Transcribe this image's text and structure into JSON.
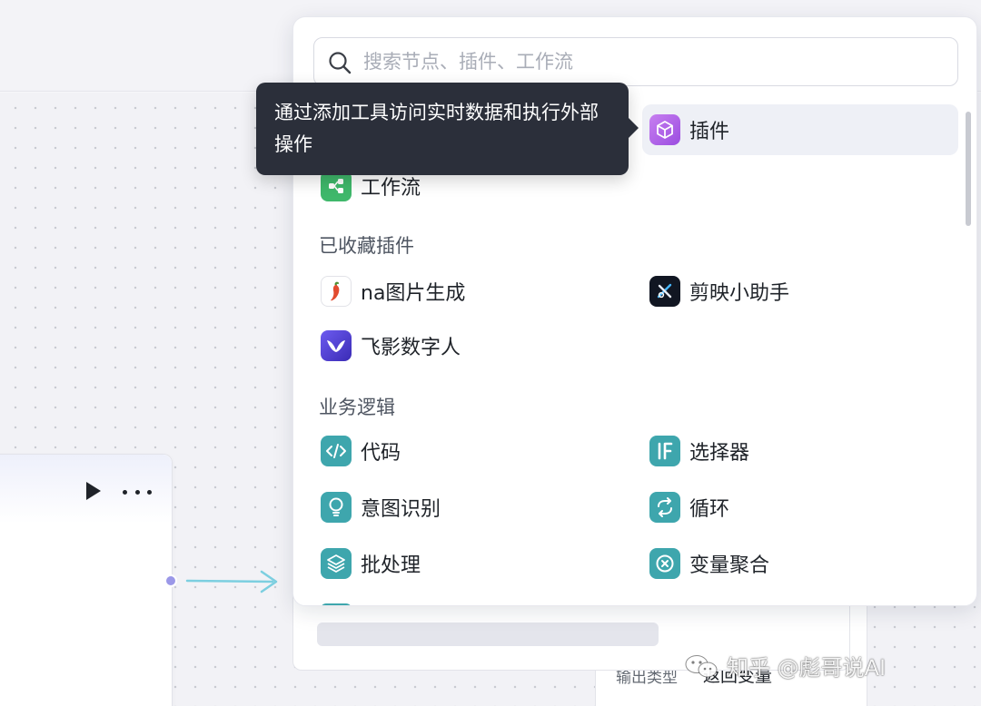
{
  "search": {
    "placeholder": "搜索节点、插件、工作流"
  },
  "tooltip": {
    "text": "通过添加工具访问实时数据和执行外部操作"
  },
  "tools": {
    "plugin_label": "插件",
    "workflow_label": "工作流"
  },
  "favorites": {
    "title": "已收藏插件",
    "items": [
      {
        "label": "na图片生成",
        "icon": "chili-pepper-icon"
      },
      {
        "label": "剪映小助手",
        "icon": "jianying-icon"
      },
      {
        "label": "飞影数字人",
        "icon": "feiying-icon"
      }
    ]
  },
  "business_logic": {
    "title": "业务逻辑",
    "items": [
      {
        "label": "代码",
        "icon": "code-icon"
      },
      {
        "label": "选择器",
        "icon": "if-selector-icon"
      },
      {
        "label": "意图识别",
        "icon": "bulb-icon"
      },
      {
        "label": "循环",
        "icon": "loop-icon"
      },
      {
        "label": "批处理",
        "icon": "layers-icon"
      },
      {
        "label": "变量聚合",
        "icon": "variable-aggregate-icon"
      }
    ]
  },
  "canvas": {
    "output_type_label": "输出类型",
    "return_variable_label": "返回变量"
  },
  "watermark": {
    "text": "知乎 @彪哥说AI"
  },
  "colors": {
    "accent_logic": "#3ea6ad",
    "tooltip_bg": "#2b2f3a",
    "port": "#9b98e8",
    "connector": "#7ccfe0"
  }
}
